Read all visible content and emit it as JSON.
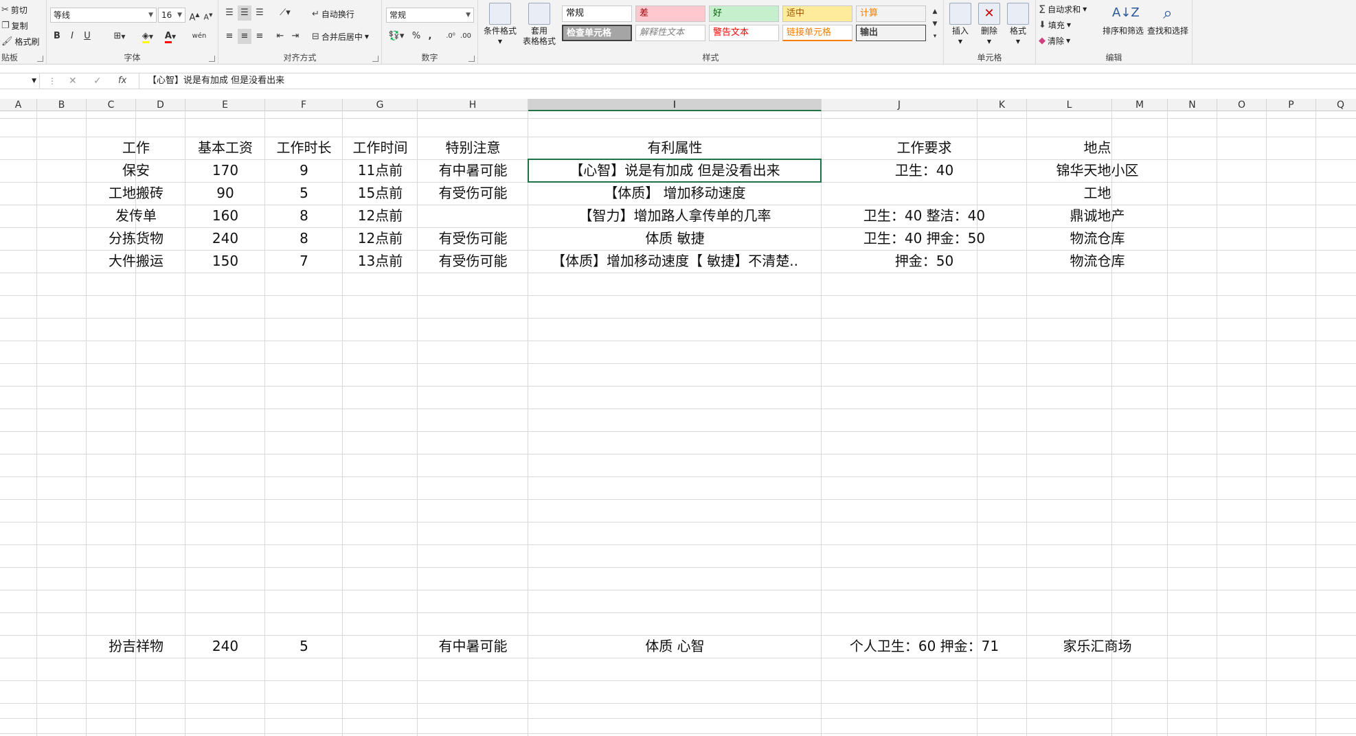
{
  "ribbon": {
    "clipboard": {
      "cut": "剪切",
      "copy": "复制",
      "painter": "格式刷",
      "label": "贴板"
    },
    "font": {
      "family": "等线",
      "size": "16",
      "label": "字体",
      "bold": "B",
      "italic": "I",
      "underline": "U",
      "font_color": "A",
      "phonetic": "wén"
    },
    "align": {
      "wrap": "自动换行",
      "merge": "合并后居中",
      "label": "对齐方式"
    },
    "number": {
      "format": "常规",
      "percent": "%",
      "comma": ",",
      "label": "数字"
    },
    "styles": {
      "cond": "条件格式",
      "table": "套用\n表格格式",
      "label": "样式",
      "cells": [
        {
          "text": "常规",
          "bg": "#ffffff",
          "fg": "#111111"
        },
        {
          "text": "差",
          "bg": "#ffc7ce",
          "fg": "#9c0006"
        },
        {
          "text": "好",
          "bg": "#c6efce",
          "fg": "#006100"
        },
        {
          "text": "适中",
          "bg": "#ffeb9c",
          "fg": "#9c5700"
        },
        {
          "text": "计算",
          "bg": "#f2f2f2",
          "fg": "#fa7d00"
        },
        {
          "text": "检查单元格",
          "bg": "#a5a5a5",
          "fg": "#ffffff"
        },
        {
          "text": "解释性文本",
          "bg": "#ffffff",
          "fg": "#7f7f7f"
        },
        {
          "text": "警告文本",
          "bg": "#ffffff",
          "fg": "#ff0000"
        },
        {
          "text": "链接单元格",
          "bg": "#ffffff",
          "fg": "#fa7d00"
        },
        {
          "text": "输出",
          "bg": "#f2f2f2",
          "fg": "#3f3f3f"
        }
      ]
    },
    "cells": {
      "insert": "插入",
      "delete": "删除",
      "format": "格式",
      "label": "单元格"
    },
    "editing": {
      "autosum": "自动求和",
      "fill": "填充",
      "clear": "清除",
      "sort": "排序和筛选",
      "find": "查找和选择",
      "label": "编辑"
    }
  },
  "formula_bar": {
    "content": "【心智】说是有加成 但是没看出来",
    "fx": "fx"
  },
  "columns": [
    {
      "id": "A",
      "w": 54
    },
    {
      "id": "B",
      "w": 72
    },
    {
      "id": "C",
      "w": 72
    },
    {
      "id": "D",
      "w": 72
    },
    {
      "id": "E",
      "w": 116
    },
    {
      "id": "F",
      "w": 113
    },
    {
      "id": "G",
      "w": 109
    },
    {
      "id": "H",
      "w": 161
    },
    {
      "id": "I",
      "w": 427
    },
    {
      "id": "J",
      "w": 227
    },
    {
      "id": "K",
      "w": 72
    },
    {
      "id": "L",
      "w": 124
    },
    {
      "id": "M",
      "w": 81
    },
    {
      "id": "N",
      "w": 72
    },
    {
      "id": "O",
      "w": 72
    },
    {
      "id": "P",
      "w": 72
    },
    {
      "id": "Q",
      "w": 72
    }
  ],
  "headers": {
    "job": "工作",
    "salary": "基本工资",
    "hours": "工作时长",
    "time": "工作时间",
    "note": "特别注意",
    "attr": "有利属性",
    "req": "工作要求",
    "place": "地点"
  },
  "rows": [
    {
      "job": "保安",
      "salary": "170",
      "hours": "9",
      "time": "11点前",
      "note": "有中暑可能",
      "attr": "【心智】说是有加成 但是没看出来",
      "req": "卫生：40",
      "place": "锦华天地小区"
    },
    {
      "job": "工地搬砖",
      "salary": "90",
      "hours": "5",
      "time": "15点前",
      "note": "有受伤可能",
      "attr": "【体质】 增加移动速度",
      "req": "",
      "place": "工地"
    },
    {
      "job": "发传单",
      "salary": "160",
      "hours": "8",
      "time": "12点前",
      "note": "",
      "attr": "【智力】增加路人拿传单的几率",
      "req": "卫生：40  整洁：40",
      "place": "鼎诚地产"
    },
    {
      "job": "分拣货物",
      "salary": "240",
      "hours": "8",
      "time": "12点前",
      "note": "有受伤可能",
      "attr": "体质 敏捷",
      "req": "卫生：40 押金：50",
      "place": "物流仓库"
    },
    {
      "job": "大件搬运",
      "salary": "150",
      "hours": "7",
      "time": "13点前",
      "note": "有受伤可能",
      "attr": "【体质】增加移动速度【 敏捷】不清楚..",
      "req": "押金：50",
      "place": "物流仓库"
    }
  ],
  "extra_row": {
    "job": "扮吉祥物",
    "salary": "240",
    "hours": "5",
    "time": "",
    "note": "有中暑可能",
    "attr": "体质  心智",
    "req": "个人卫生：60 押金：71",
    "place": "家乐汇商场"
  }
}
